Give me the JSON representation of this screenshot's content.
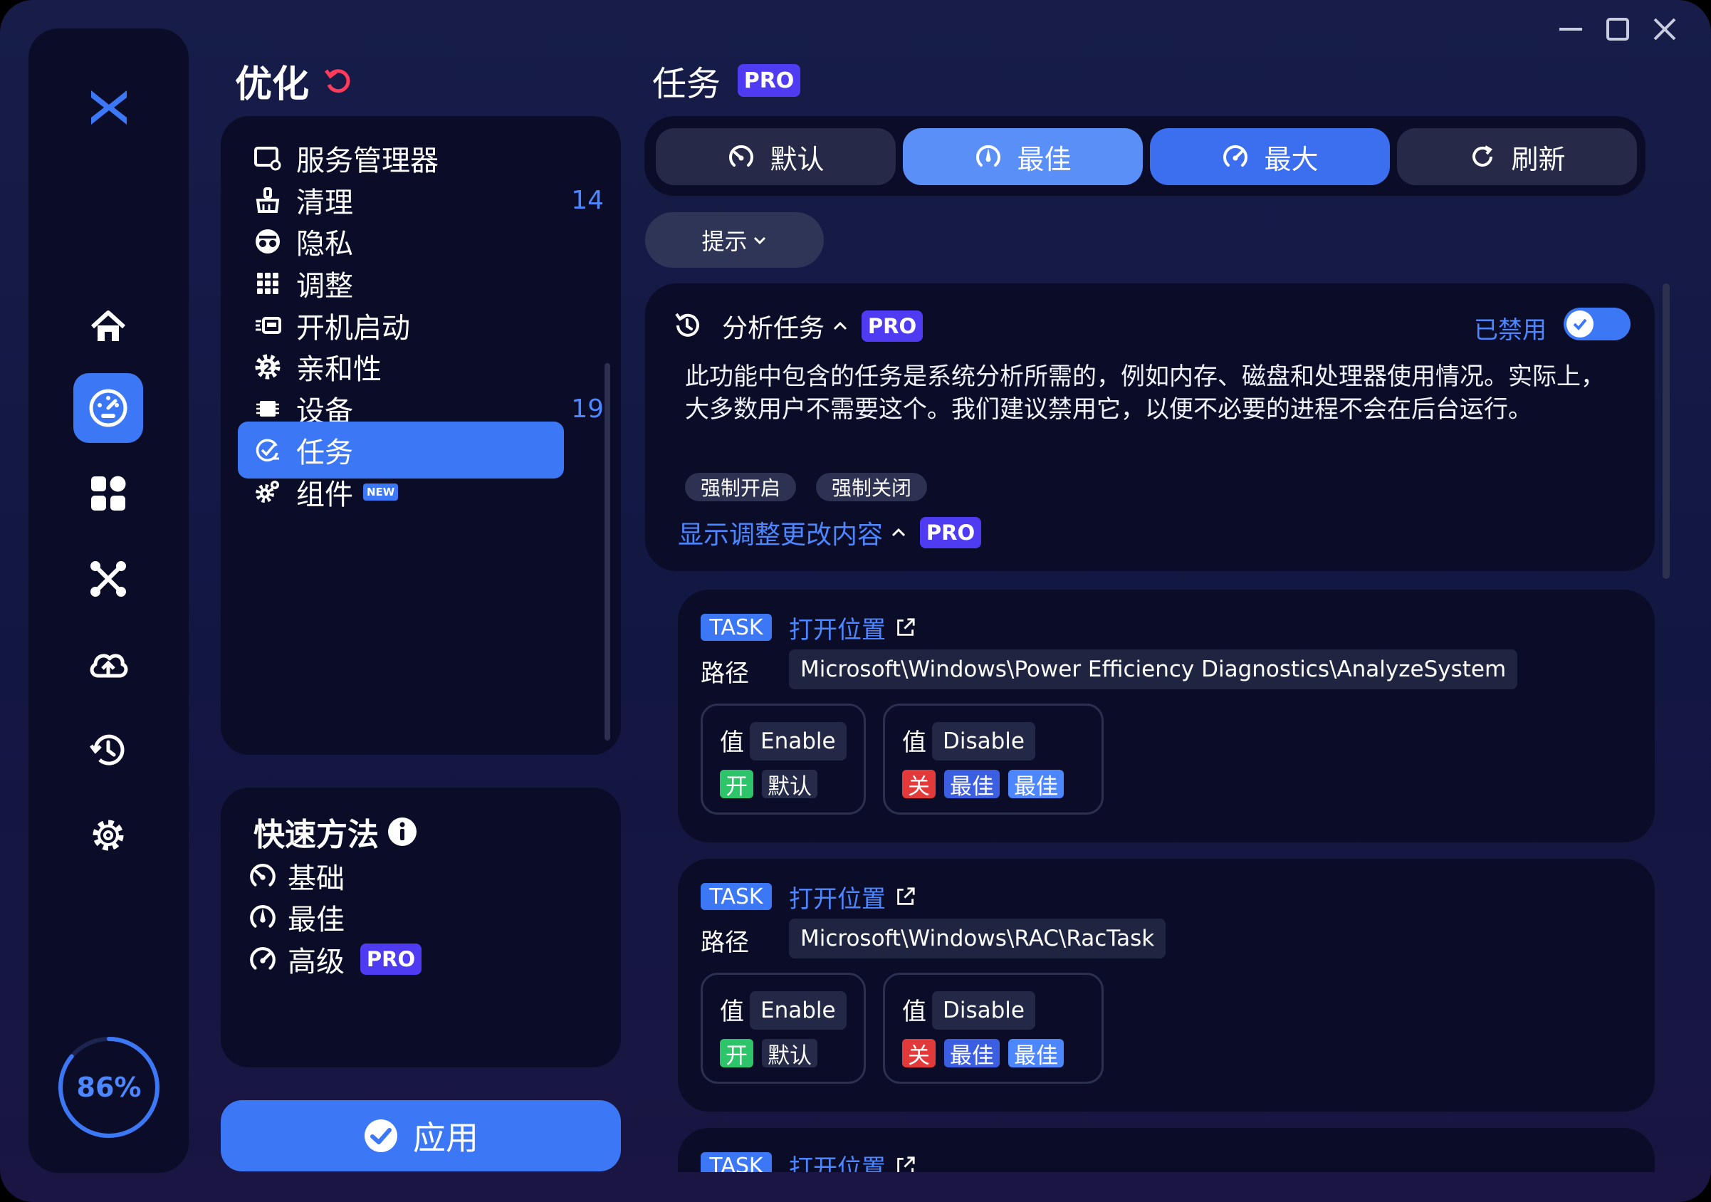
{
  "colors": {
    "accent": "#3c78f5",
    "link": "#4d87ff",
    "pro_badge": "#4f3bf2",
    "panel": "#0b0d28",
    "on_green": "#2ec46a",
    "off_red": "#e23a3a"
  },
  "window": {
    "controls": [
      "minimize-icon",
      "maximize-icon",
      "close-icon"
    ]
  },
  "rail": {
    "logo": "app-logo-icon",
    "items": [
      {
        "icon": "home-icon",
        "active": false
      },
      {
        "icon": "gauge-icon",
        "active": true
      },
      {
        "icon": "apps-grid-icon",
        "active": false
      },
      {
        "icon": "network-icon",
        "active": false
      },
      {
        "icon": "cloud-upload-icon",
        "active": false
      },
      {
        "icon": "history-icon",
        "active": false
      },
      {
        "icon": "gear-icon",
        "active": false
      }
    ],
    "score": "86%",
    "score_fraction": 0.86
  },
  "optimize": {
    "title": "优化",
    "reset_icon": "undo-icon",
    "nav": [
      {
        "label": "服务管理器",
        "count": "",
        "icon": "service-manager-icon",
        "active": false,
        "new": false
      },
      {
        "label": "清理",
        "count": "14",
        "icon": "broom-icon",
        "active": false,
        "new": false
      },
      {
        "label": "隐私",
        "count": "",
        "icon": "incognito-icon",
        "active": false,
        "new": false
      },
      {
        "label": "调整",
        "count": "",
        "icon": "grid-dots-icon",
        "active": false,
        "new": false
      },
      {
        "label": "开机启动",
        "count": "",
        "icon": "startup-icon",
        "active": false,
        "new": false
      },
      {
        "label": "亲和性",
        "count": "",
        "icon": "cpu-affinity-icon",
        "active": false,
        "new": false
      },
      {
        "label": "设备",
        "count": "19",
        "icon": "chip-icon",
        "active": false,
        "new": false
      },
      {
        "label": "任务",
        "count": "",
        "icon": "task-check-icon",
        "active": true,
        "new": false
      },
      {
        "label": "组件",
        "count": "",
        "icon": "gears-icon",
        "active": false,
        "new": true
      }
    ],
    "new_badge": "NEW"
  },
  "quick": {
    "title": "快速方法",
    "info_icon": "info-icon",
    "items": [
      {
        "label": "基础",
        "icon": "speed-low-icon",
        "pro": false
      },
      {
        "label": "最佳",
        "icon": "speed-mid-icon",
        "pro": false
      },
      {
        "label": "高级",
        "icon": "speed-high-icon",
        "pro": true
      }
    ]
  },
  "pro_label": "PRO",
  "apply": {
    "label": "应用"
  },
  "tasks": {
    "title": "任务",
    "modes": [
      {
        "label": "默认",
        "icon": "speed-low-icon",
        "bg": "#262a48"
      },
      {
        "label": "最佳",
        "icon": "speed-mid-icon",
        "bg": "#5a8ff7"
      },
      {
        "label": "最大",
        "icon": "speed-high-icon",
        "bg": "#3c6ff0"
      },
      {
        "label": "刷新",
        "icon": "refresh-icon",
        "bg": "#262a48"
      }
    ],
    "hint": "提示"
  },
  "analysis": {
    "title": "分析任务",
    "status": "已禁用",
    "enabled": true,
    "description": "此功能中包含的任务是系统分析所需的，例如内存、磁盘和处理器使用情况。实际上，大多数用户不需要这个。我们建议禁用它，以便不必要的进程不会在后台运行。",
    "chips": [
      "强制开启",
      "强制关闭"
    ],
    "show_changes": "显示调整更改内容"
  },
  "task_items": [
    {
      "tag": "TASK",
      "open": "打开位置",
      "path_label": "路径",
      "path": "Microsoft\\Windows\\Power Efficiency Diagnostics\\AnalyzeSystem",
      "value_label": "值",
      "enable": {
        "value": "Enable",
        "state": "开",
        "modes": [
          "默认"
        ]
      },
      "disable": {
        "value": "Disable",
        "state": "关",
        "modes": [
          "最佳",
          "最佳"
        ]
      }
    },
    {
      "tag": "TASK",
      "open": "打开位置",
      "path_label": "路径",
      "path": "Microsoft\\Windows\\RAC\\RacTask",
      "value_label": "值",
      "enable": {
        "value": "Enable",
        "state": "开",
        "modes": [
          "默认"
        ]
      },
      "disable": {
        "value": "Disable",
        "state": "关",
        "modes": [
          "最佳",
          "最佳"
        ]
      }
    },
    {
      "tag": "TASK",
      "open": "打开位置"
    }
  ]
}
